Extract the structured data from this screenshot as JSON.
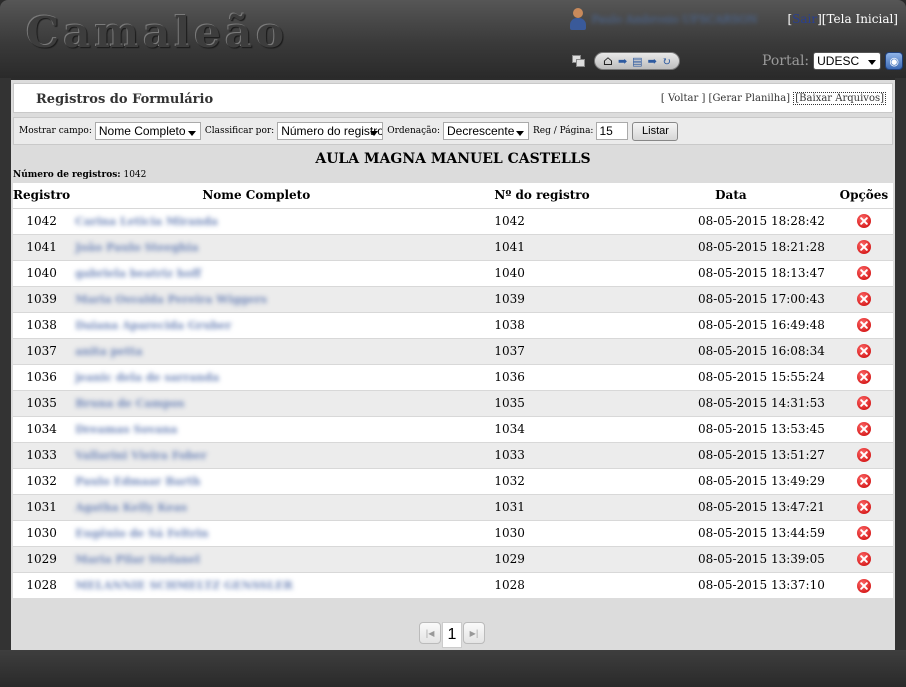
{
  "app": {
    "logo": "Camaleão"
  },
  "header": {
    "user_name": "Paulo Ambrosio UFSCARSON",
    "links_sep_open": "[",
    "sair_label": "Sair",
    "tela_inicial": "][Tela Inicial]",
    "portal_label": "Portal:",
    "portal_value": "UDESC"
  },
  "panel": {
    "title": "Registros do Formulário",
    "links": {
      "voltar": "[ Voltar ]",
      "gerar": "[Gerar Planilha]",
      "baixar": "[Baixar Arquivos]"
    }
  },
  "filters": {
    "mostrar_label": "Mostrar campo:",
    "mostrar_value": "Nome Completo",
    "classificar_label": "Classificar por:",
    "classificar_value": "Número do registro",
    "ordenacao_label": "Ordenação:",
    "ordenacao_value": "Decrescente",
    "reg_label": "Reg / Página:",
    "reg_value": "15",
    "listar_label": "Listar"
  },
  "form_title": "AULA MAGNA MANUEL CASTELLS",
  "count": {
    "label": "Número de registros:",
    "value": "1042"
  },
  "table": {
    "headers": [
      "Registro",
      "Nome Completo",
      "Nº do registro",
      "Data",
      "Opções"
    ],
    "rows": [
      {
        "reg": "1042",
        "name": "Carina Leticia Miranda",
        "num": "1042",
        "date": "08-05-2015 18:28:42"
      },
      {
        "reg": "1041",
        "name": "João Paulo Steeghia",
        "num": "1041",
        "date": "08-05-2015 18:21:28"
      },
      {
        "reg": "1040",
        "name": "gabriela beatriz hoff",
        "num": "1040",
        "date": "08-05-2015 18:13:47"
      },
      {
        "reg": "1039",
        "name": "Maria Osvalda Pereira Wiggers",
        "num": "1039",
        "date": "08-05-2015 17:00:43"
      },
      {
        "reg": "1038",
        "name": "Daiana Aparecida Gruber",
        "num": "1038",
        "date": "08-05-2015 16:49:48"
      },
      {
        "reg": "1037",
        "name": "anita petta",
        "num": "1037",
        "date": "08-05-2015 16:08:34"
      },
      {
        "reg": "1036",
        "name": "jeanic dela de sarranda",
        "num": "1036",
        "date": "08-05-2015 15:55:24"
      },
      {
        "reg": "1035",
        "name": "Bruna de Campos",
        "num": "1035",
        "date": "08-05-2015 14:31:53"
      },
      {
        "reg": "1034",
        "name": "Dreamas Sovana",
        "num": "1034",
        "date": "08-05-2015 13:53:45"
      },
      {
        "reg": "1033",
        "name": "Vallarini Vieira Fober",
        "num": "1033",
        "date": "08-05-2015 13:51:27"
      },
      {
        "reg": "1032",
        "name": "Paulo Edmaar Barth",
        "num": "1032",
        "date": "08-05-2015 13:49:29"
      },
      {
        "reg": "1031",
        "name": "Agatha Kelly Keas",
        "num": "1031",
        "date": "08-05-2015 13:47:21"
      },
      {
        "reg": "1030",
        "name": "Eugênio de Sá Feltrin",
        "num": "1030",
        "date": "08-05-2015 13:44:59"
      },
      {
        "reg": "1029",
        "name": "Maria Pilar Stefanel",
        "num": "1029",
        "date": "08-05-2015 13:39:05"
      },
      {
        "reg": "1028",
        "name": "MELANNIE SCHMELTZ GENSSLER",
        "num": "1028",
        "date": "08-05-2015 13:37:10"
      }
    ]
  },
  "pager": {
    "current": "1"
  },
  "icons": {
    "delete": "delete-icon",
    "home": "home-icon",
    "globe": "globe-icon"
  }
}
